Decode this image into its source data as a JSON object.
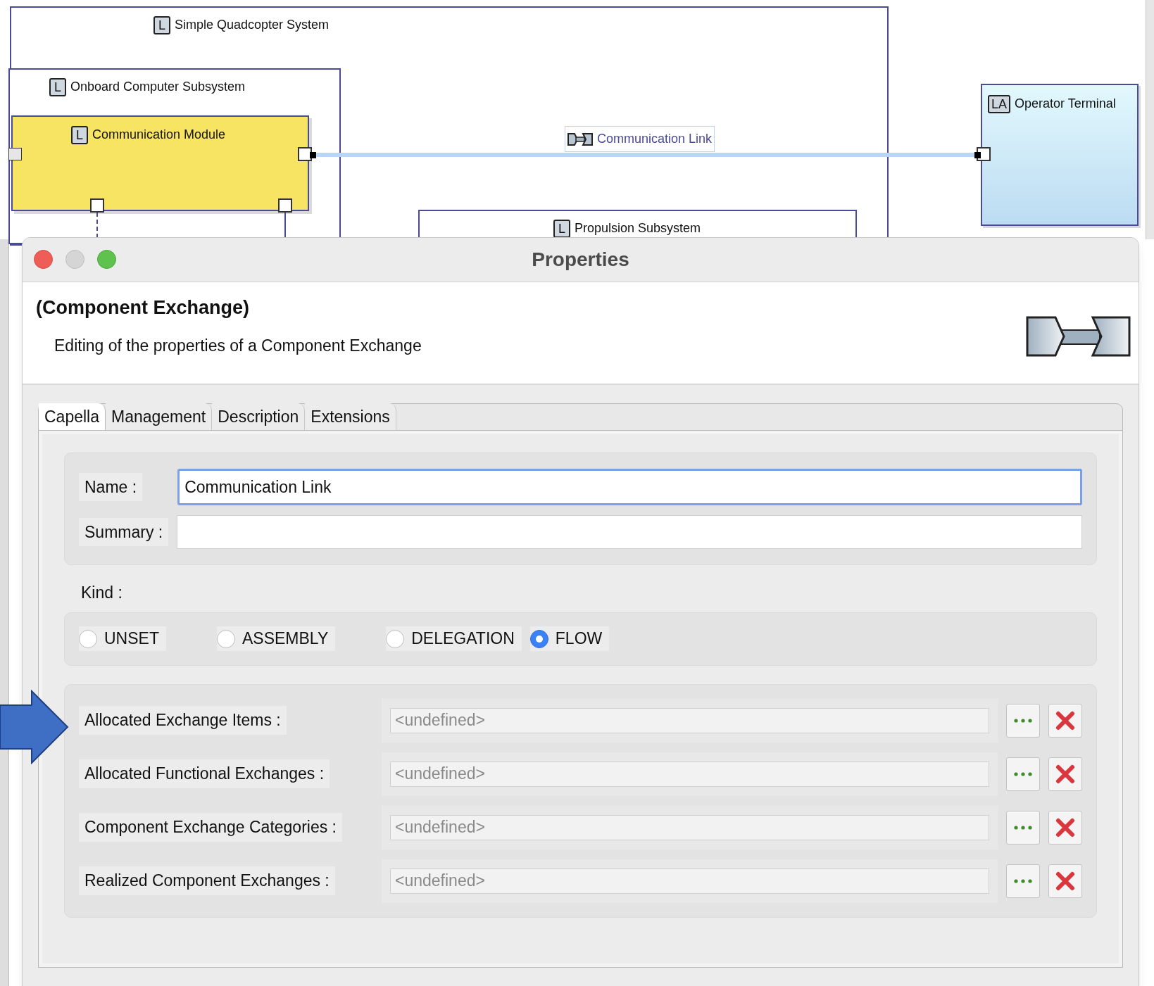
{
  "diagram": {
    "nodes": [
      {
        "kind": "frame",
        "icon": "L",
        "label": "Simple Quadcopter System"
      },
      {
        "kind": "frame",
        "icon": "L",
        "label": "Onboard Computer Subsystem"
      },
      {
        "kind": "component",
        "icon": "L",
        "label": "Communication Module"
      },
      {
        "kind": "frame",
        "icon": "L",
        "label": "Propulsion Subsystem"
      },
      {
        "kind": "actor",
        "icon": "LA",
        "label": "Operator Terminal"
      }
    ],
    "link_label": "Communication Link"
  },
  "dialog": {
    "title": "Properties",
    "heading": "(Component Exchange)",
    "description": "Editing of the properties of a Component Exchange",
    "tabs": [
      {
        "label": "Capella",
        "selected": true
      },
      {
        "label": "Management",
        "selected": false
      },
      {
        "label": "Description",
        "selected": false
      },
      {
        "label": "Extensions",
        "selected": false
      }
    ],
    "name_label": "Name :",
    "name_value": "Communication Link",
    "summary_label": "Summary :",
    "kind_label": "Kind :",
    "kinds": [
      {
        "label": "UNSET",
        "selected": false
      },
      {
        "label": "ASSEMBLY",
        "selected": false
      },
      {
        "label": "DELEGATION",
        "selected": false
      },
      {
        "label": "FLOW",
        "selected": true
      }
    ],
    "references": [
      {
        "label": "Allocated Exchange Items :",
        "placeholder": "<undefined>"
      },
      {
        "label": "Allocated Functional Exchanges :",
        "placeholder": "<undefined>"
      },
      {
        "label": "Component Exchange Categories :",
        "placeholder": "<undefined>"
      },
      {
        "label": "Realized Component Exchanges :",
        "placeholder": "<undefined>"
      }
    ]
  }
}
